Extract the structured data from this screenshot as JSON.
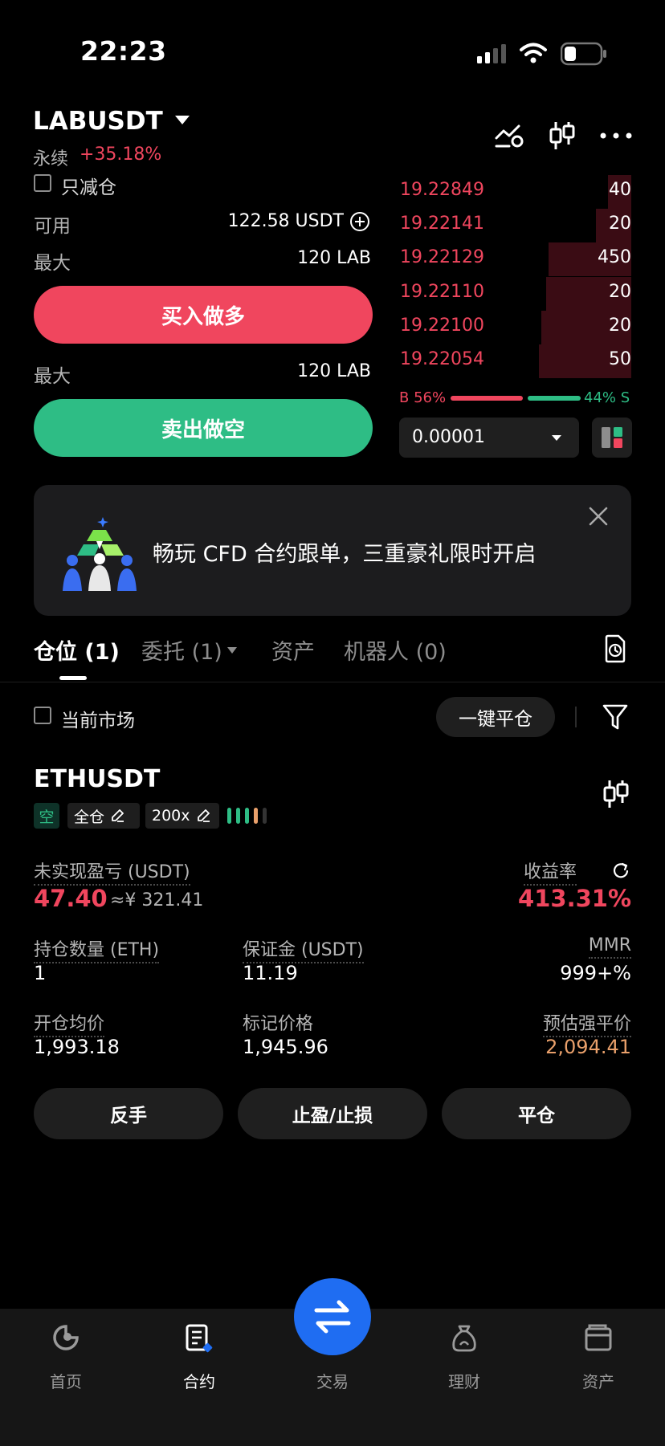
{
  "status_bar": {
    "time": "22:23"
  },
  "header": {
    "pair": "LABUSDT",
    "contract_type": "永续",
    "change": "+35.18%",
    "icons": [
      "chart-settings-icon",
      "candlestick-icon",
      "more-icon"
    ]
  },
  "order_form": {
    "reduce_only_label": "只减仓",
    "available_label": "可用",
    "available_value": "122.58 USDT",
    "max_buy_label": "最大",
    "max_buy_value": "120 LAB",
    "buy_button": "买入做多",
    "max_sell_label": "最大",
    "max_sell_value": "120 LAB",
    "sell_button": "卖出做空"
  },
  "order_book": {
    "asks": [
      {
        "price": "19.22849",
        "qty": "40",
        "depth": 0.1
      },
      {
        "price": "19.22141",
        "qty": "20",
        "depth": 0.15
      },
      {
        "price": "19.22129",
        "qty": "450",
        "depth": 0.35
      },
      {
        "price": "19.22110",
        "qty": "20",
        "depth": 0.36
      },
      {
        "price": "19.22100",
        "qty": "20",
        "depth": 0.38
      },
      {
        "price": "19.22054",
        "qty": "50",
        "depth": 0.39
      }
    ],
    "buy_ratio": "B 56%",
    "sell_ratio": "44% S",
    "precision": "0.00001",
    "colors": {
      "ask": "#f0465e",
      "bid": "#2ebd85"
    }
  },
  "banner": {
    "text": "畅玩 CFD 合约跟单，三重豪礼限时开启"
  },
  "tabs": {
    "positions": "仓位 (1)",
    "orders": "委托 (1)",
    "assets": "资产",
    "bots": "机器人 (0)"
  },
  "filter_bar": {
    "current_market_label": "当前市场",
    "close_all_button": "一键平仓"
  },
  "position": {
    "symbol": "ETHUSDT",
    "side": "空",
    "margin_mode": "全仓",
    "leverage": "200x",
    "upnl_label": "未实现盈亏 (USDT)",
    "upnl_value": "47.40",
    "upnl_cny": "≈¥ 321.41",
    "roe_label": "收益率",
    "roe_value": "413.31%",
    "size_label": "持仓数量 (ETH)",
    "size_value": "1",
    "margin_label": "保证金 (USDT)",
    "margin_value": "11.19",
    "mmr_label": "MMR",
    "mmr_value": "999+%",
    "entry_label": "开仓均价",
    "entry_value": "1,993.18",
    "mark_label": "标记价格",
    "mark_value": "1,945.96",
    "liq_label": "预估强平价",
    "liq_value": "2,094.41",
    "buttons": {
      "reverse": "反手",
      "tpsl": "止盈/止损",
      "close": "平仓"
    }
  },
  "bottom_nav": {
    "home": "首页",
    "futures": "合约",
    "trade": "交易",
    "earn": "理财",
    "assets": "资产"
  }
}
